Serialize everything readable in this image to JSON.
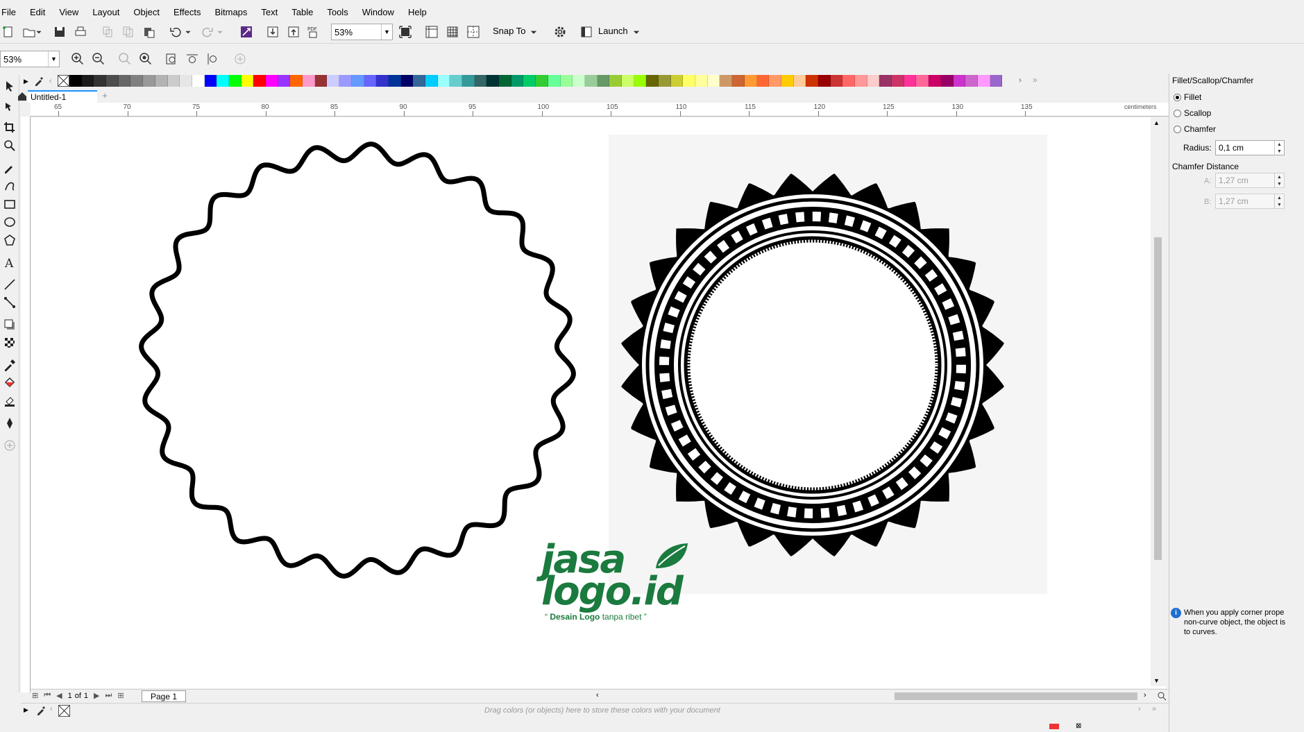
{
  "menu": [
    "File",
    "Edit",
    "View",
    "Layout",
    "Object",
    "Effects",
    "Bitmaps",
    "Text",
    "Table",
    "Tools",
    "Window",
    "Help"
  ],
  "toolbar": {
    "zoom_value": "53%",
    "snap_label": "Snap To",
    "launch_label": "Launch"
  },
  "property_bar": {
    "zoom_value": "53%"
  },
  "document_tab": {
    "title": "Untitled-1"
  },
  "ruler": {
    "h_ticks": [
      "65",
      "70",
      "75",
      "80",
      "85",
      "90",
      "95",
      "100",
      "105",
      "110",
      "115",
      "120",
      "125",
      "130",
      "135"
    ],
    "unit": "centimeters"
  },
  "page_nav": {
    "current": "1",
    "of_label": "of",
    "total": "1",
    "page_tab": "Page 1"
  },
  "document_palette_hint": "Drag colors (or objects) here to store these colors with your document",
  "docker": {
    "title": "Fillet/Scallop/Chamfer",
    "options": [
      {
        "label": "Fillet",
        "selected": true
      },
      {
        "label": "Scallop",
        "selected": false
      },
      {
        "label": "Chamfer",
        "selected": false
      }
    ],
    "radius_label": "Radius:",
    "radius_value": "0,1 cm",
    "chamfer_distance_label": "Chamfer Distance",
    "a_label": "A:",
    "a_value": "1,27 cm",
    "b_label": "B:",
    "b_value": "1,27 cm",
    "info_text_line1": "When you apply corner prope",
    "info_text_line2": "non-curve object, the object is",
    "info_text_line3": "to curves."
  },
  "watermark": {
    "brand_line1": "jasa",
    "brand_line2": "logo.id",
    "tagline_bold": "Desain Logo",
    "tagline_rest": "tanpa ribet",
    "color": "#1b7a3e"
  },
  "palette_colors": [
    "#000000",
    "#1a1a1a",
    "#333333",
    "#4d4d4d",
    "#666666",
    "#808080",
    "#999999",
    "#b3b3b3",
    "#cccccc",
    "#e6e6e6",
    "#ffffff",
    "#0000ff",
    "#00ffff",
    "#00ff00",
    "#ffff00",
    "#ff0000",
    "#ff00ff",
    "#9933ff",
    "#ff6600",
    "#ff99cc",
    "#993333",
    "#ccccff",
    "#9999ff",
    "#6699ff",
    "#6666ff",
    "#3333cc",
    "#003399",
    "#000066",
    "#336699",
    "#00ccff",
    "#99ffff",
    "#66cccc",
    "#339999",
    "#336666",
    "#003333",
    "#006633",
    "#009966",
    "#00cc66",
    "#33cc33",
    "#66ff99",
    "#99ff99",
    "#ccffcc",
    "#99cc99",
    "#669966",
    "#99cc33",
    "#ccff66",
    "#99ff00",
    "#666600",
    "#999933",
    "#cccc33",
    "#ffff66",
    "#ffff99",
    "#ffffcc",
    "#cc9966",
    "#cc6633",
    "#ff9933",
    "#ff6633",
    "#ff9966",
    "#ffcc00",
    "#ffcc99",
    "#cc3300",
    "#990000",
    "#cc3333",
    "#ff6666",
    "#ff9999",
    "#ffcccc",
    "#993366",
    "#cc3366",
    "#ff3399",
    "#ff6699",
    "#cc0066",
    "#990066",
    "#cc33cc",
    "#cc66cc",
    "#ff99ff",
    "#9966cc"
  ]
}
